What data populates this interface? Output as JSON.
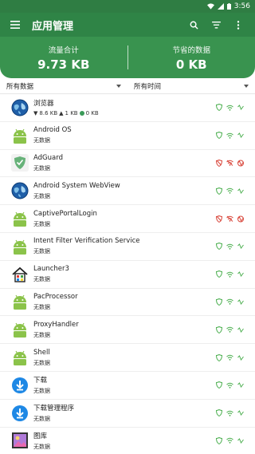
{
  "status": {
    "time": "3:56"
  },
  "appbar": {
    "title": "应用管理",
    "icons": [
      "menu-icon",
      "search-icon",
      "filter-icon",
      "more-icon"
    ]
  },
  "summary": {
    "left_label": "流量合计",
    "left_value": "9.73 KB",
    "right_label": "节省的数据",
    "right_value": "0 KB"
  },
  "filters": {
    "data_select": "所有数据",
    "time_select": "所有时间"
  },
  "colors": {
    "green_dark": "#2f7d43",
    "green": "#39934f",
    "allow": "#4caf50",
    "block": "#d9473c"
  },
  "apps": [
    {
      "name": "浏览器",
      "icon": "globe-icon",
      "down": "8.6 KB",
      "up": "1 KB",
      "saved": "0 KB",
      "state": "allow"
    },
    {
      "name": "Android OS",
      "icon": "android-icon",
      "sub": "无数据",
      "state": "allow"
    },
    {
      "name": "AdGuard",
      "icon": "adguard-shield-icon",
      "sub": "无数据",
      "state": "block"
    },
    {
      "name": "Android System WebView",
      "icon": "globe-icon",
      "sub": "无数据",
      "state": "allow"
    },
    {
      "name": "CaptivePortalLogin",
      "icon": "android-icon",
      "sub": "无数据",
      "state": "block"
    },
    {
      "name": "Intent Filter Verification Service",
      "icon": "android-icon",
      "sub": "无数据",
      "state": "allow"
    },
    {
      "name": "Launcher3",
      "icon": "house-icon",
      "sub": "无数据",
      "state": "allow"
    },
    {
      "name": "PacProcessor",
      "icon": "android-icon",
      "sub": "无数据",
      "state": "allow"
    },
    {
      "name": "ProxyHandler",
      "icon": "android-icon",
      "sub": "无数据",
      "state": "allow"
    },
    {
      "name": "Shell",
      "icon": "android-icon",
      "sub": "无数据",
      "state": "allow"
    },
    {
      "name": "下载",
      "icon": "download-icon",
      "sub": "无数据",
      "state": "allow"
    },
    {
      "name": "下载管理程序",
      "icon": "download-icon",
      "sub": "无数据",
      "state": "allow"
    },
    {
      "name": "图库",
      "icon": "gallery-icon",
      "sub": "无数据",
      "state": "allow"
    }
  ]
}
